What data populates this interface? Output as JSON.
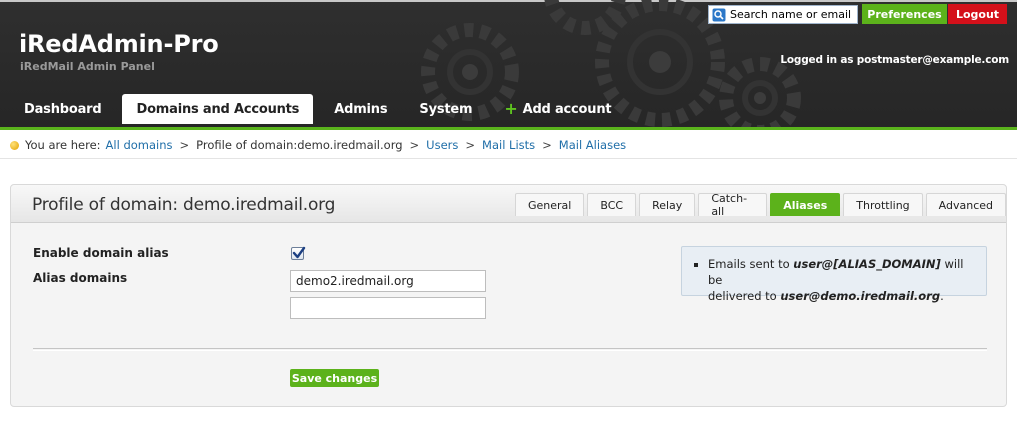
{
  "header": {
    "title": "iRedAdmin-Pro",
    "subtitle": "iRedMail Admin Panel",
    "search_placeholder": "Search name or email",
    "preferences_label": "Preferences",
    "logout_label": "Logout",
    "logged_in_text": "Logged in as postmaster@example.com"
  },
  "nav": {
    "items": [
      {
        "label": "Dashboard"
      },
      {
        "label": "Domains and Accounts",
        "active": true
      },
      {
        "label": "Admins"
      },
      {
        "label": "System"
      },
      {
        "label": "Add account",
        "icon": "plus-icon"
      }
    ]
  },
  "breadcrumb": {
    "prefix": "You are here:",
    "all_domains": "All domains",
    "profile": "Profile of domain:demo.iredmail.org",
    "users": "Users",
    "mail_lists": "Mail Lists",
    "mail_aliases": "Mail Aliases",
    "separator": ">"
  },
  "panel": {
    "title": "Profile of domain: demo.iredmail.org",
    "tabs": [
      {
        "label": "General"
      },
      {
        "label": "BCC"
      },
      {
        "label": "Relay"
      },
      {
        "label": "Catch-all"
      },
      {
        "label": "Aliases",
        "active": true
      },
      {
        "label": "Throttling"
      },
      {
        "label": "Advanced"
      }
    ],
    "enable_alias_label": "Enable domain alias",
    "enable_alias_checked": true,
    "alias_domains_label": "Alias domains",
    "alias_domain_1": "demo2.iredmail.org",
    "alias_domain_2": "",
    "info_line_prefix": "Emails sent to ",
    "info_alias_placeholder": "user@[ALIAS_DOMAIN]",
    "info_line_mid": " will be",
    "info_line2_prefix": "delivered to ",
    "info_target": "user@demo.iredmail.org",
    "info_line2_suffix": ".",
    "save_label": "Save changes"
  },
  "colors": {
    "accent_green": "#5cb21b",
    "logout_red": "#d4101a",
    "link_blue": "#1f6ea8",
    "header_bg": "#2a2a2a"
  }
}
